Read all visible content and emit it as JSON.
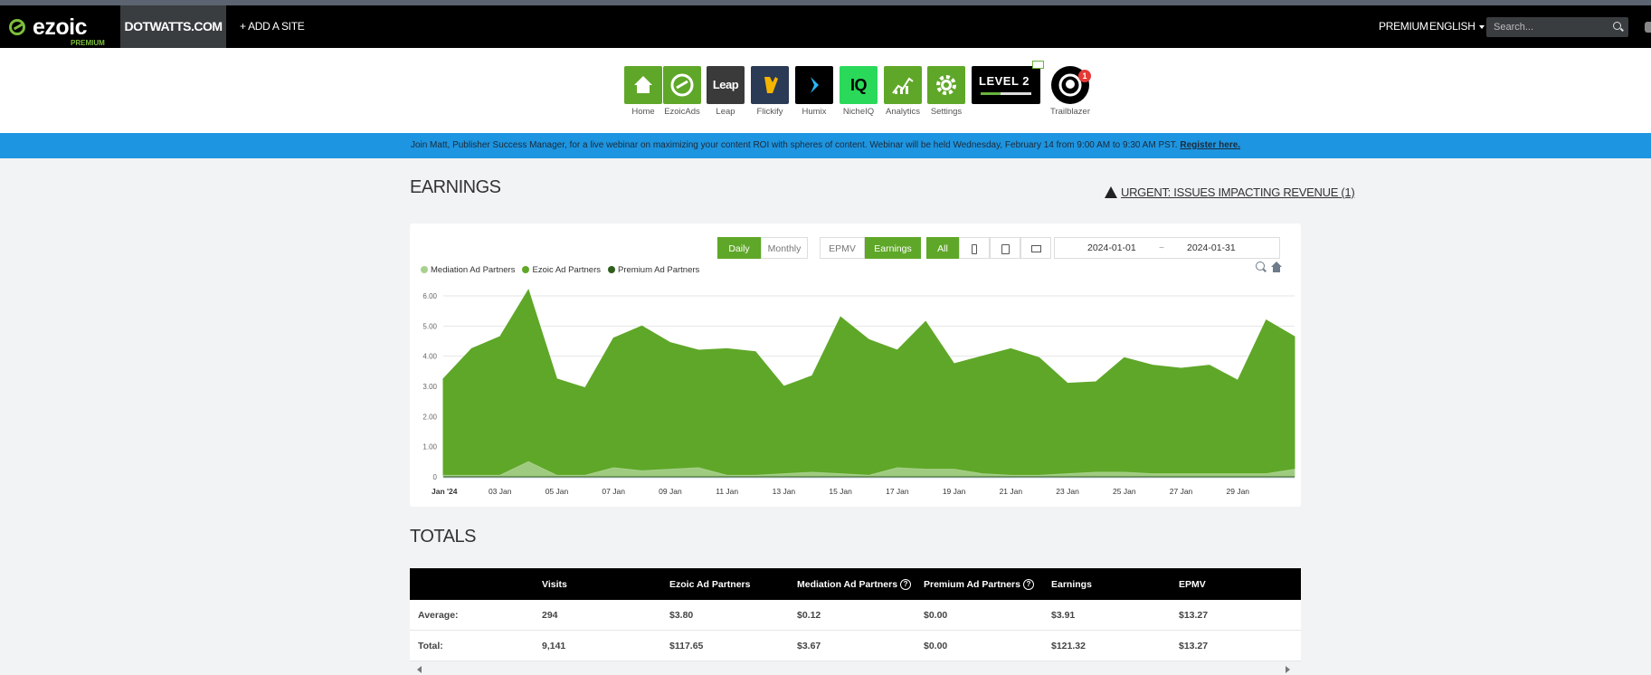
{
  "header": {
    "logo_word": "ezoic",
    "logo_sub": "PREMIUM",
    "site": "DOTWATTS.COM",
    "add_site": "+ ADD A SITE",
    "premium": "PREMIUM",
    "language": "ENGLISH",
    "search_placeholder": "Search..."
  },
  "apps": [
    {
      "label": "Home",
      "color": "#5fa728",
      "icon": "home-icon"
    },
    {
      "label": "EzoicAds",
      "color": "#5fa728",
      "icon": "ezoic-ads-icon"
    },
    {
      "label": "Leap",
      "color": "#3a3a3a",
      "icon": "leap-icon",
      "text": "Leap"
    },
    {
      "label": "Flickify",
      "color": "#2b3a55",
      "icon": "flickify-icon"
    },
    {
      "label": "Humix",
      "color": "#000000",
      "icon": "humix-icon"
    },
    {
      "label": "NicheIQ",
      "color": "#2bd95a",
      "icon": "nicheiq-icon",
      "text": "IQ"
    },
    {
      "label": "Analytics",
      "color": "#5fa728",
      "icon": "analytics-icon"
    },
    {
      "label": "Settings",
      "color": "#5fa728",
      "icon": "settings-icon"
    }
  ],
  "level": {
    "text": "LEVEL 2",
    "progress": 0.4
  },
  "trailblazer": {
    "label": "Trailblazer",
    "badge": "1"
  },
  "banner": {
    "text": "Join Matt, Publisher Success Manager, for a live webinar on maximizing your content ROI with spheres of content. Webinar will be held Wednesday, February 14 from 9:00 AM to 9:30 AM PST.",
    "link": "Register here."
  },
  "earnings": {
    "title": "EARNINGS",
    "urgent": "URGENT: ISSUES IMPACTING REVENUE (1)",
    "period_buttons": [
      "Daily",
      "Monthly"
    ],
    "metric_buttons": [
      "EPMV",
      "Earnings"
    ],
    "device_all": "All",
    "date_start": "2024-01-01",
    "date_sep": "~",
    "date_end": "2024-01-31"
  },
  "chart_data": {
    "type": "area",
    "title": "",
    "xlabel": "",
    "ylabel": "",
    "ylim": [
      0,
      6
    ],
    "y_ticks": [
      "6.00",
      "5.00",
      "4.00",
      "3.00",
      "2.00",
      "1.00",
      "0"
    ],
    "x_ticks": [
      {
        "day": 1,
        "label": "Jan '24"
      },
      {
        "day": 3,
        "label": "03 Jan"
      },
      {
        "day": 5,
        "label": "05 Jan"
      },
      {
        "day": 7,
        "label": "07 Jan"
      },
      {
        "day": 9,
        "label": "09 Jan"
      },
      {
        "day": 11,
        "label": "11 Jan"
      },
      {
        "day": 13,
        "label": "13 Jan"
      },
      {
        "day": 15,
        "label": "15 Jan"
      },
      {
        "day": 17,
        "label": "17 Jan"
      },
      {
        "day": 19,
        "label": "19 Jan"
      },
      {
        "day": 21,
        "label": "21 Jan"
      },
      {
        "day": 23,
        "label": "23 Jan"
      },
      {
        "day": 25,
        "label": "25 Jan"
      },
      {
        "day": 27,
        "label": "27 Jan"
      },
      {
        "day": 29,
        "label": "29 Jan"
      }
    ],
    "x": [
      1,
      2,
      3,
      4,
      5,
      6,
      7,
      8,
      9,
      10,
      11,
      12,
      13,
      14,
      15,
      16,
      17,
      18,
      19,
      20,
      21,
      22,
      23,
      24,
      25,
      26,
      27,
      28,
      29,
      30,
      31
    ],
    "legend_position": "top-left",
    "series": [
      {
        "name": "Mediation Ad Partners",
        "color": "#a9d18e",
        "values": [
          0.05,
          0.05,
          0.05,
          0.5,
          0.05,
          0.05,
          0.3,
          0.2,
          0.25,
          0.3,
          0.05,
          0.05,
          0.1,
          0.15,
          0.1,
          0.05,
          0.3,
          0.25,
          0.25,
          0.1,
          0.05,
          0.05,
          0.1,
          0.15,
          0.15,
          0.1,
          0.1,
          0.1,
          0.1,
          0.1,
          0.25
        ]
      },
      {
        "name": "Ezoic Ad Partners",
        "color": "#5fa728",
        "values": [
          3.2,
          4.2,
          4.6,
          5.7,
          3.2,
          2.9,
          4.3,
          4.8,
          4.2,
          3.9,
          4.2,
          4.1,
          2.9,
          3.2,
          5.2,
          4.5,
          3.9,
          4.9,
          3.5,
          3.9,
          4.2,
          3.9,
          3.0,
          3.0,
          3.8,
          3.6,
          3.5,
          3.6,
          3.1,
          5.1,
          4.4
        ]
      },
      {
        "name": "Premium Ad Partners",
        "color": "#2f5e1a",
        "values": [
          0,
          0,
          0,
          0,
          0,
          0,
          0,
          0,
          0,
          0,
          0,
          0,
          0,
          0,
          0,
          0,
          0,
          0,
          0,
          0,
          0,
          0,
          0,
          0,
          0,
          0,
          0,
          0,
          0,
          0,
          0
        ]
      }
    ]
  },
  "totals": {
    "title": "TOTALS",
    "columns": [
      "",
      "Visits",
      "Ezoic Ad Partners",
      "Mediation Ad Partners",
      "Premium Ad Partners",
      "Earnings",
      "EPMV"
    ],
    "rows": [
      [
        "Average:",
        "294",
        "$3.80",
        "$0.12",
        "$0.00",
        "$3.91",
        "$13.27"
      ],
      [
        "Total:",
        "9,141",
        "$117.65",
        "$3.67",
        "$0.00",
        "$121.32",
        "$13.27"
      ]
    ]
  }
}
